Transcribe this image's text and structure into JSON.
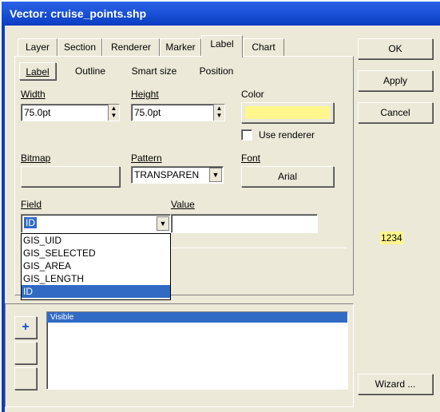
{
  "window": {
    "title": "Vector: cruise_points.shp"
  },
  "tabs": [
    "Layer",
    "Section",
    "Renderer",
    "Marker",
    "Label",
    "Chart"
  ],
  "subtabs": [
    "Label",
    "Outline",
    "Smart size",
    "Position"
  ],
  "form": {
    "width_label": "Width",
    "width_value": "75.0pt",
    "height_label": "Height",
    "height_value": "75.0pt",
    "color_label": "Color",
    "color_value": "#fff78c",
    "use_renderer_label": "Use renderer",
    "bitmap_label": "Bitmap",
    "pattern_label": "Pattern",
    "pattern_value": "TRANSPAREN",
    "font_label": "Font",
    "font_value": "Arial",
    "field_label": "Field",
    "field_value": "ID",
    "value_label": "Value",
    "value_value": ""
  },
  "field_options": [
    "GIS_UID",
    "GIS_SELECTED",
    "GIS_AREA",
    "GIS_LENGTH",
    "ID"
  ],
  "field_selected": "ID",
  "side_buttons": {
    "ok": "OK",
    "apply": "Apply",
    "cancel": "Cancel",
    "wizard": "Wizard ..."
  },
  "preview_text": "1234",
  "sections": {
    "list_items": [
      "Visible"
    ],
    "add_button": "+"
  }
}
